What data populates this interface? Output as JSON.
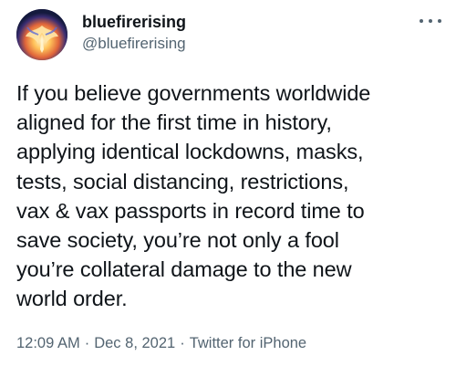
{
  "user": {
    "display_name": "bluefirerising",
    "handle": "@bluefirerising",
    "avatar_icon": "phoenix-avatar-icon"
  },
  "menu": {
    "icon": "more-horizontal-icon"
  },
  "tweet": {
    "lines": [
      "If you believe governments worldwide",
      "aligned for the first time in history,",
      "applying identical lockdowns, masks,",
      "tests, social distancing, restrictions,",
      "vax & vax passports in record time to",
      "save society, you’re not only a fool",
      "you’re collateral damage to the new",
      "world order."
    ]
  },
  "meta": {
    "time": "12:09 AM",
    "separator": "·",
    "date": "Dec 8, 2021",
    "source": "Twitter for iPhone"
  },
  "colors": {
    "text_primary": "#0f1419",
    "text_secondary": "#536471",
    "background": "#ffffff"
  }
}
